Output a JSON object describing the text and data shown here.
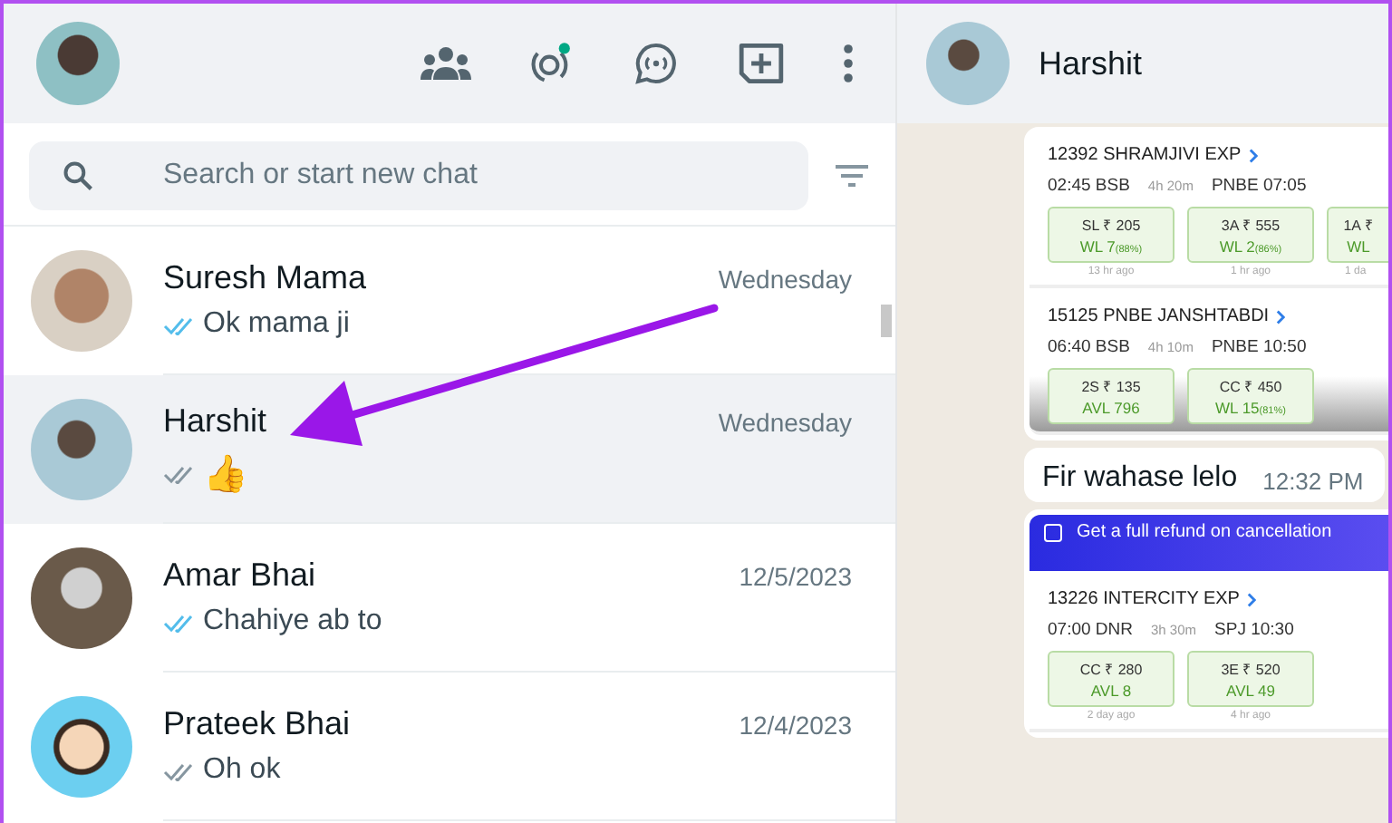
{
  "search": {
    "placeholder": "Search or start new chat"
  },
  "chats": [
    {
      "name": "Suresh Mama",
      "time": "Wednesday",
      "message": "Ok mama ji",
      "read": true,
      "selected": false
    },
    {
      "name": "Harshit",
      "time": "Wednesday",
      "message": "👍",
      "read": false,
      "selected": true
    },
    {
      "name": "Amar Bhai",
      "time": "12/5/2023",
      "message": "Chahiye ab to",
      "read": true,
      "selected": false
    },
    {
      "name": "Prateek Bhai",
      "time": "12/4/2023",
      "message": "Oh ok",
      "read": false,
      "selected": false
    }
  ],
  "conversation": {
    "title": "Harshit",
    "first_image": {
      "trains": [
        {
          "name": "12392 SHRAMJIVI EXP",
          "departure": "02:45 BSB",
          "duration": "4h 20m",
          "arrival": "PNBE 07:05",
          "classes": [
            {
              "fare": "SL ₹ 205",
              "availability": "WL 7",
              "chance": "(88%)",
              "updated": "13 hr ago"
            },
            {
              "fare": "3A ₹ 555",
              "availability": "WL 2",
              "chance": "(86%)",
              "updated": "1 hr ago"
            },
            {
              "fare": "1A ₹",
              "availability": "WL",
              "updated": "1 da"
            }
          ]
        },
        {
          "name": "15125 PNBE JANSHTABDI",
          "departure": "06:40 BSB",
          "duration": "4h 10m",
          "arrival": "PNBE 10:50",
          "classes": [
            {
              "fare": "2S ₹ 135",
              "availability": "AVL 796"
            },
            {
              "fare": "CC ₹ 450",
              "availability": "WL 15",
              "chance": "(81%)"
            }
          ]
        }
      ]
    },
    "message": {
      "text": "Fir wahase lelo",
      "time": "12:32 PM"
    },
    "second_image": {
      "banner": {
        "text": "Get a full refund on cancellation",
        "checked": false
      },
      "trains": [
        {
          "name": "13226 INTERCITY EXP",
          "departure": "07:00 DNR",
          "duration": "3h 30m",
          "arrival": "SPJ 10:30",
          "classes": [
            {
              "fare": "CC ₹ 280",
              "availability": "AVL 8",
              "updated": "2 day ago"
            },
            {
              "fare": "3E ₹ 520",
              "availability": "AVL 49",
              "updated": "4 hr ago"
            }
          ]
        }
      ]
    }
  }
}
